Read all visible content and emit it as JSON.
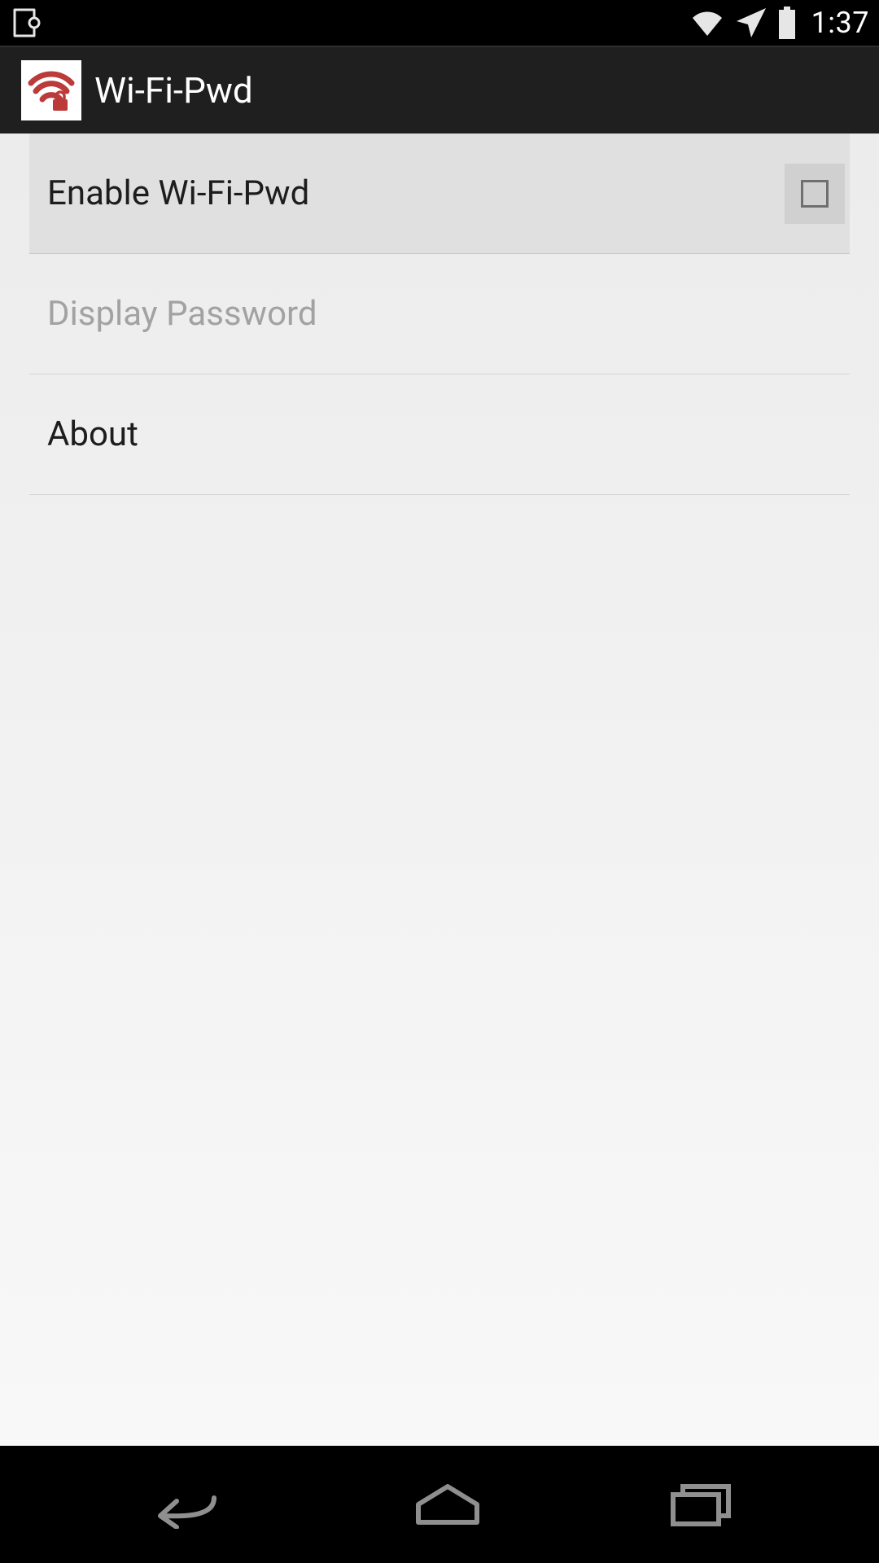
{
  "status_bar": {
    "time": "1:37"
  },
  "action_bar": {
    "title": "Wi-Fi-Pwd"
  },
  "settings": {
    "enable_label": "Enable Wi-Fi-Pwd",
    "enable_checked": false,
    "display_password_label": "Display Password",
    "about_label": "About"
  }
}
